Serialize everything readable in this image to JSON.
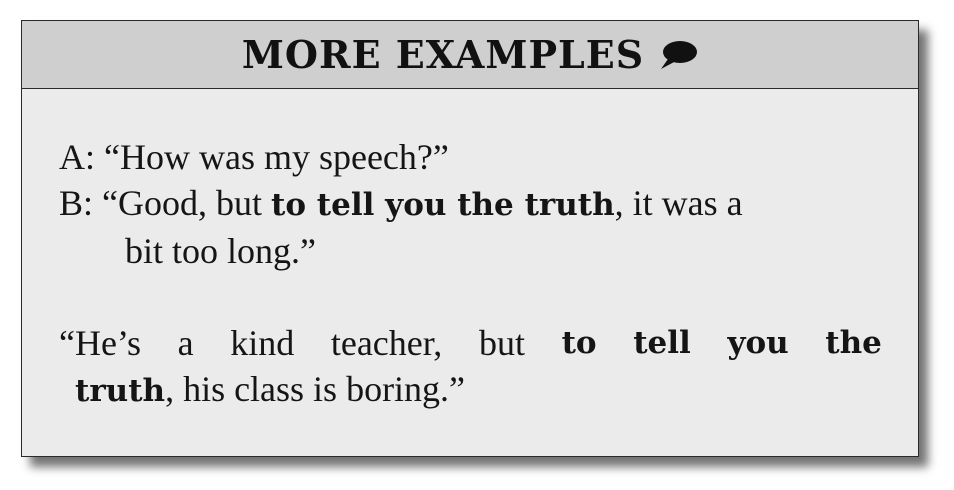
{
  "header": {
    "title": "MORE EXAMPLES",
    "icon": "speech-bubble-icon"
  },
  "dialogue": {
    "a_line": "A: “How was my speech?”",
    "b_prefix": "B: “Good, but ",
    "b_bold": "to tell you the truth",
    "b_suffix": ", it was a",
    "b_continuation": "bit too long.”"
  },
  "example2": {
    "w1": "“He’s",
    "w2": "a",
    "w3": "kind",
    "w4": "teacher,",
    "w5": "but",
    "bold1": "to",
    "bold2": "tell",
    "bold3": "you",
    "bold4": "the",
    "line2_bold": "truth",
    "line2_rest": ", his class is boring.”"
  },
  "colors": {
    "header_bg": "#cfcfcf",
    "card_bg": "#ebebeb",
    "text": "#151515"
  }
}
